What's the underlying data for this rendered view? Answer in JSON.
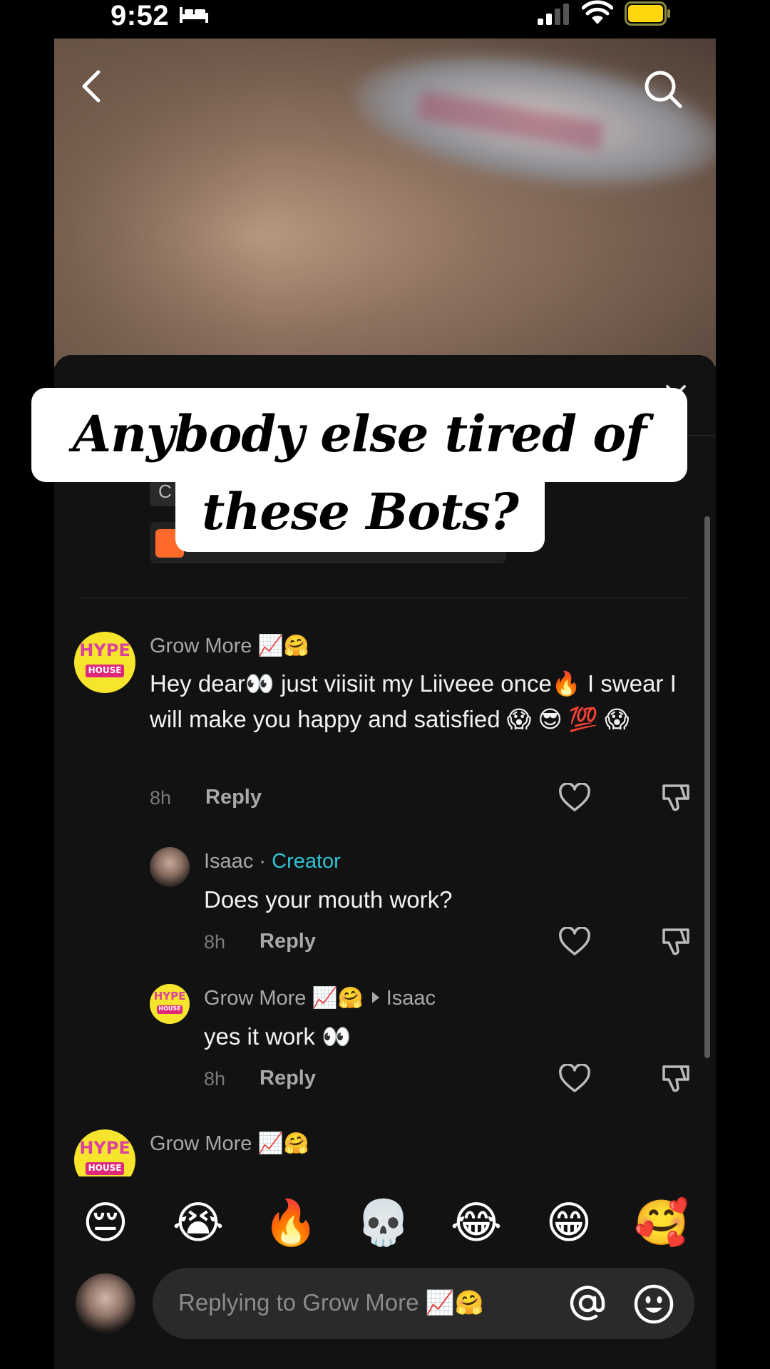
{
  "status_bar": {
    "time": "9:52"
  },
  "caption": {
    "line1": "Anybody else tired of",
    "line2": "these Bots?"
  },
  "product": {
    "chip_letter": "C"
  },
  "comments": [
    {
      "user": "Grow More 📈🤗",
      "text": "Hey dear👀 just viisiit my Liiveee once🔥 I swear I will make you happy and satisfied 😱 😎 💯 😱",
      "time": "8h",
      "reply_label": "Reply"
    },
    {
      "user": "Isaac",
      "separator": "·",
      "badge": "Creator",
      "text": "Does your mouth work?",
      "time": "8h",
      "reply_label": "Reply"
    },
    {
      "user": "Grow More 📈🤗",
      "reply_to": "Isaac",
      "text": "yes it work 👀",
      "time": "8h",
      "reply_label": "Reply"
    },
    {
      "user": "Grow More 📈🤗"
    }
  ],
  "avatar_label": {
    "top": "HYPE",
    "bottom": "HOUSE"
  },
  "quick_emojis": [
    "😔",
    "😭",
    "🔥",
    "💀",
    "😂",
    "😁",
    "🥰"
  ],
  "reply_input": {
    "placeholder": "Replying to Grow More 📈🤗"
  },
  "colors": {
    "creator_badge": "#2ec4d6",
    "sheet_bg": "#121212",
    "caption_bg": "#ffffff"
  },
  "icons": [
    "bed-icon",
    "signal-icon",
    "wifi-icon",
    "battery-icon",
    "back-icon",
    "search-icon",
    "heart-icon",
    "dislike-icon",
    "at-icon",
    "emoji-picker-icon"
  ]
}
